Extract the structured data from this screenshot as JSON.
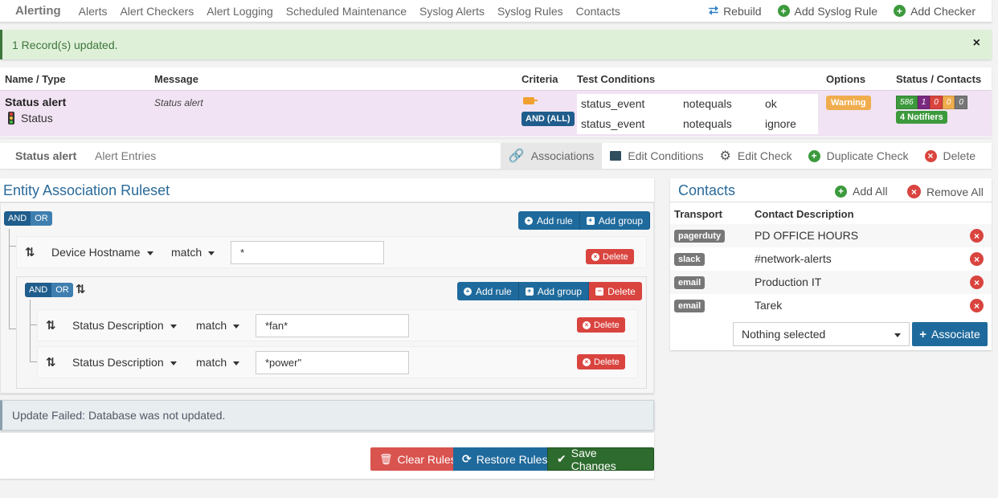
{
  "nav": {
    "brand": "Alerting",
    "links": [
      "Alerts",
      "Alert Checkers",
      "Alert Logging",
      "Scheduled Maintenance",
      "Syslog Alerts",
      "Syslog Rules",
      "Contacts"
    ],
    "actions": {
      "rebuild": "Rebuild",
      "add_syslog_rule": "Add Syslog Rule",
      "add_checker": "Add Checker"
    }
  },
  "alert_success": {
    "message": "1 Record(s) updated.",
    "close": "×"
  },
  "check_table": {
    "headers": {
      "name_type": "Name / Type",
      "message": "Message",
      "criteria": "Criteria",
      "test_conditions": "Test Conditions",
      "options": "Options",
      "status_contacts": "Status / Contacts"
    },
    "row": {
      "name": "Status alert",
      "type": "Status",
      "message": "Status alert",
      "criteria_badge": "AND (ALL)",
      "conditions": [
        {
          "field": "status_event",
          "op": "notequals",
          "value": "ok"
        },
        {
          "field": "status_event",
          "op": "notequals",
          "value": "ignore"
        }
      ],
      "option_badge": "Warning",
      "status_badges": [
        {
          "value": "586",
          "color": "#3c9a3c"
        },
        {
          "value": "1",
          "color": "#7a2a80"
        },
        {
          "value": "0",
          "color": "#d9443f"
        },
        {
          "value": "0",
          "color": "#f0ad4e"
        },
        {
          "value": "0",
          "color": "#777777"
        }
      ],
      "notifiers": "4 Notifiers"
    }
  },
  "tabs": {
    "title": "Status alert",
    "entries_link": "Alert Entries",
    "actions": {
      "associations": "Associations",
      "edit_conditions": "Edit Conditions",
      "edit_check": "Edit Check",
      "duplicate_check": "Duplicate Check",
      "delete": "Delete"
    }
  },
  "ruleset": {
    "title": "Entity Association Ruleset",
    "and_label": "AND",
    "or_label": "OR",
    "add_rule": "Add rule",
    "add_group": "Add group",
    "delete": "Delete",
    "root_rule": {
      "field": "Device Hostname",
      "operator": "match",
      "value": "*"
    },
    "subgroup_rules": [
      {
        "field": "Status Description",
        "operator": "match",
        "value": "*fan*"
      },
      {
        "field": "Status Description",
        "operator": "match",
        "value": "*power\""
      }
    ]
  },
  "alert_fail": {
    "message": "Update Failed: Database was not updated."
  },
  "actions": {
    "clear_rules": "Clear Rules",
    "restore_rules": "Restore Rules",
    "save_changes": "Save Changes"
  },
  "contacts": {
    "title": "Contacts",
    "add_all": "Add All",
    "remove_all": "Remove All",
    "headers": {
      "transport": "Transport",
      "description": "Contact Description"
    },
    "rows": [
      {
        "transport": "pagerduty",
        "description": "PD OFFICE HOURS"
      },
      {
        "transport": "slack",
        "description": "#network-alerts"
      },
      {
        "transport": "email",
        "description": "Production IT"
      },
      {
        "transport": "email",
        "description": "Tarek"
      }
    ],
    "select_placeholder": "Nothing selected",
    "associate": "Associate"
  }
}
